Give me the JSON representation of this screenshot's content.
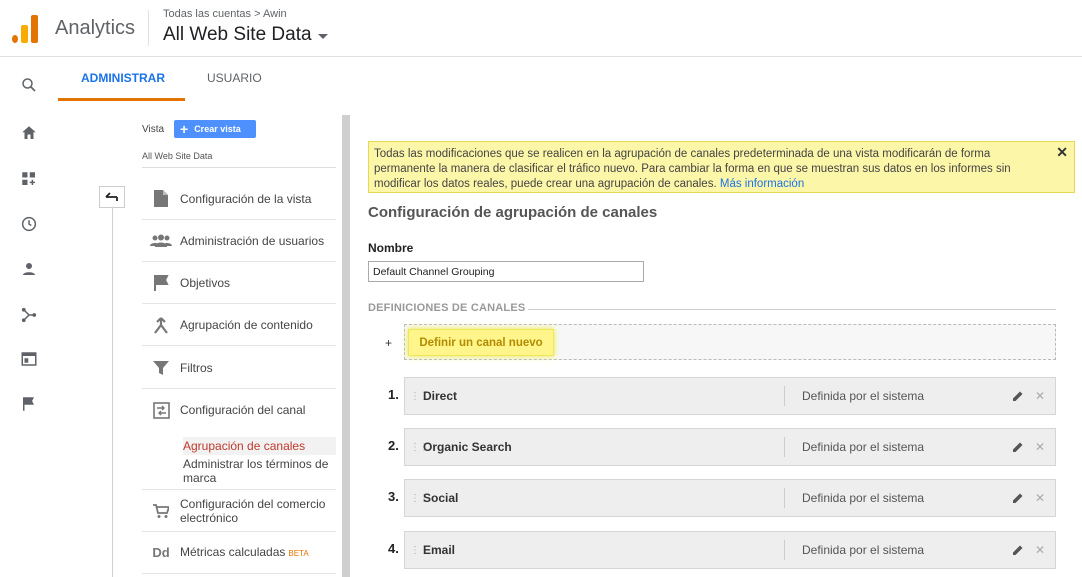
{
  "header": {
    "app_title": "Analytics",
    "breadcrumb": "Todas las cuentas > Awin",
    "view_name": "All Web Site Data"
  },
  "tabs": {
    "admin": "ADMINISTRAR",
    "user": "USUARIO"
  },
  "admin_nav": {
    "vista_label": "Vista",
    "create_view": "Crear vista",
    "current_view": "All Web Site Data",
    "items": [
      {
        "label": "Configuración de la vista",
        "icon": "document-icon"
      },
      {
        "label": "Administración de usuarios",
        "icon": "people-icon"
      },
      {
        "label": "Objetivos",
        "icon": "flag-icon"
      },
      {
        "label": "Agrupación de contenido",
        "icon": "merge-icon"
      },
      {
        "label": "Filtros",
        "icon": "filter-icon"
      },
      {
        "label": "Configuración del canal",
        "icon": "channel-icon"
      },
      {
        "label": "Configuración del comercio electrónico",
        "icon": "cart-icon"
      },
      {
        "label": "Métricas calculadas",
        "icon": "dd-icon"
      }
    ],
    "sub_items": [
      "Agrupación de canales",
      "Administrar los términos de marca"
    ],
    "beta": "BETA"
  },
  "notice": {
    "text": "Todas las modificaciones que se realicen en la agrupación de canales predeterminada de una vista modificarán de forma permanente la manera de clasificar el tráfico nuevo. Para cambiar la forma en que se muestran sus datos en los informes sin modificar los datos reales, puede crear una agrupación de canales.",
    "link": "Más información",
    "close": "✕"
  },
  "main": {
    "title": "Configuración de agrupación de canales",
    "name_label": "Nombre",
    "name_value": "Default Channel Grouping",
    "definitions_header": "DEFINICIONES DE CANALES",
    "add_plus": "+",
    "add_button": "Definir un canal nuevo",
    "rows": [
      {
        "num": "1.",
        "name": "Direct",
        "def": "Definida por el sistema"
      },
      {
        "num": "2.",
        "name": "Organic Search",
        "def": "Definida por el sistema"
      },
      {
        "num": "3.",
        "name": "Social",
        "def": "Definida por el sistema"
      },
      {
        "num": "4.",
        "name": "Email",
        "def": "Definida por el sistema"
      }
    ]
  },
  "colors": {
    "accent_blue": "#1a73e8",
    "accent_orange": "#e37400",
    "highlight_yellow": "#fff58a"
  }
}
